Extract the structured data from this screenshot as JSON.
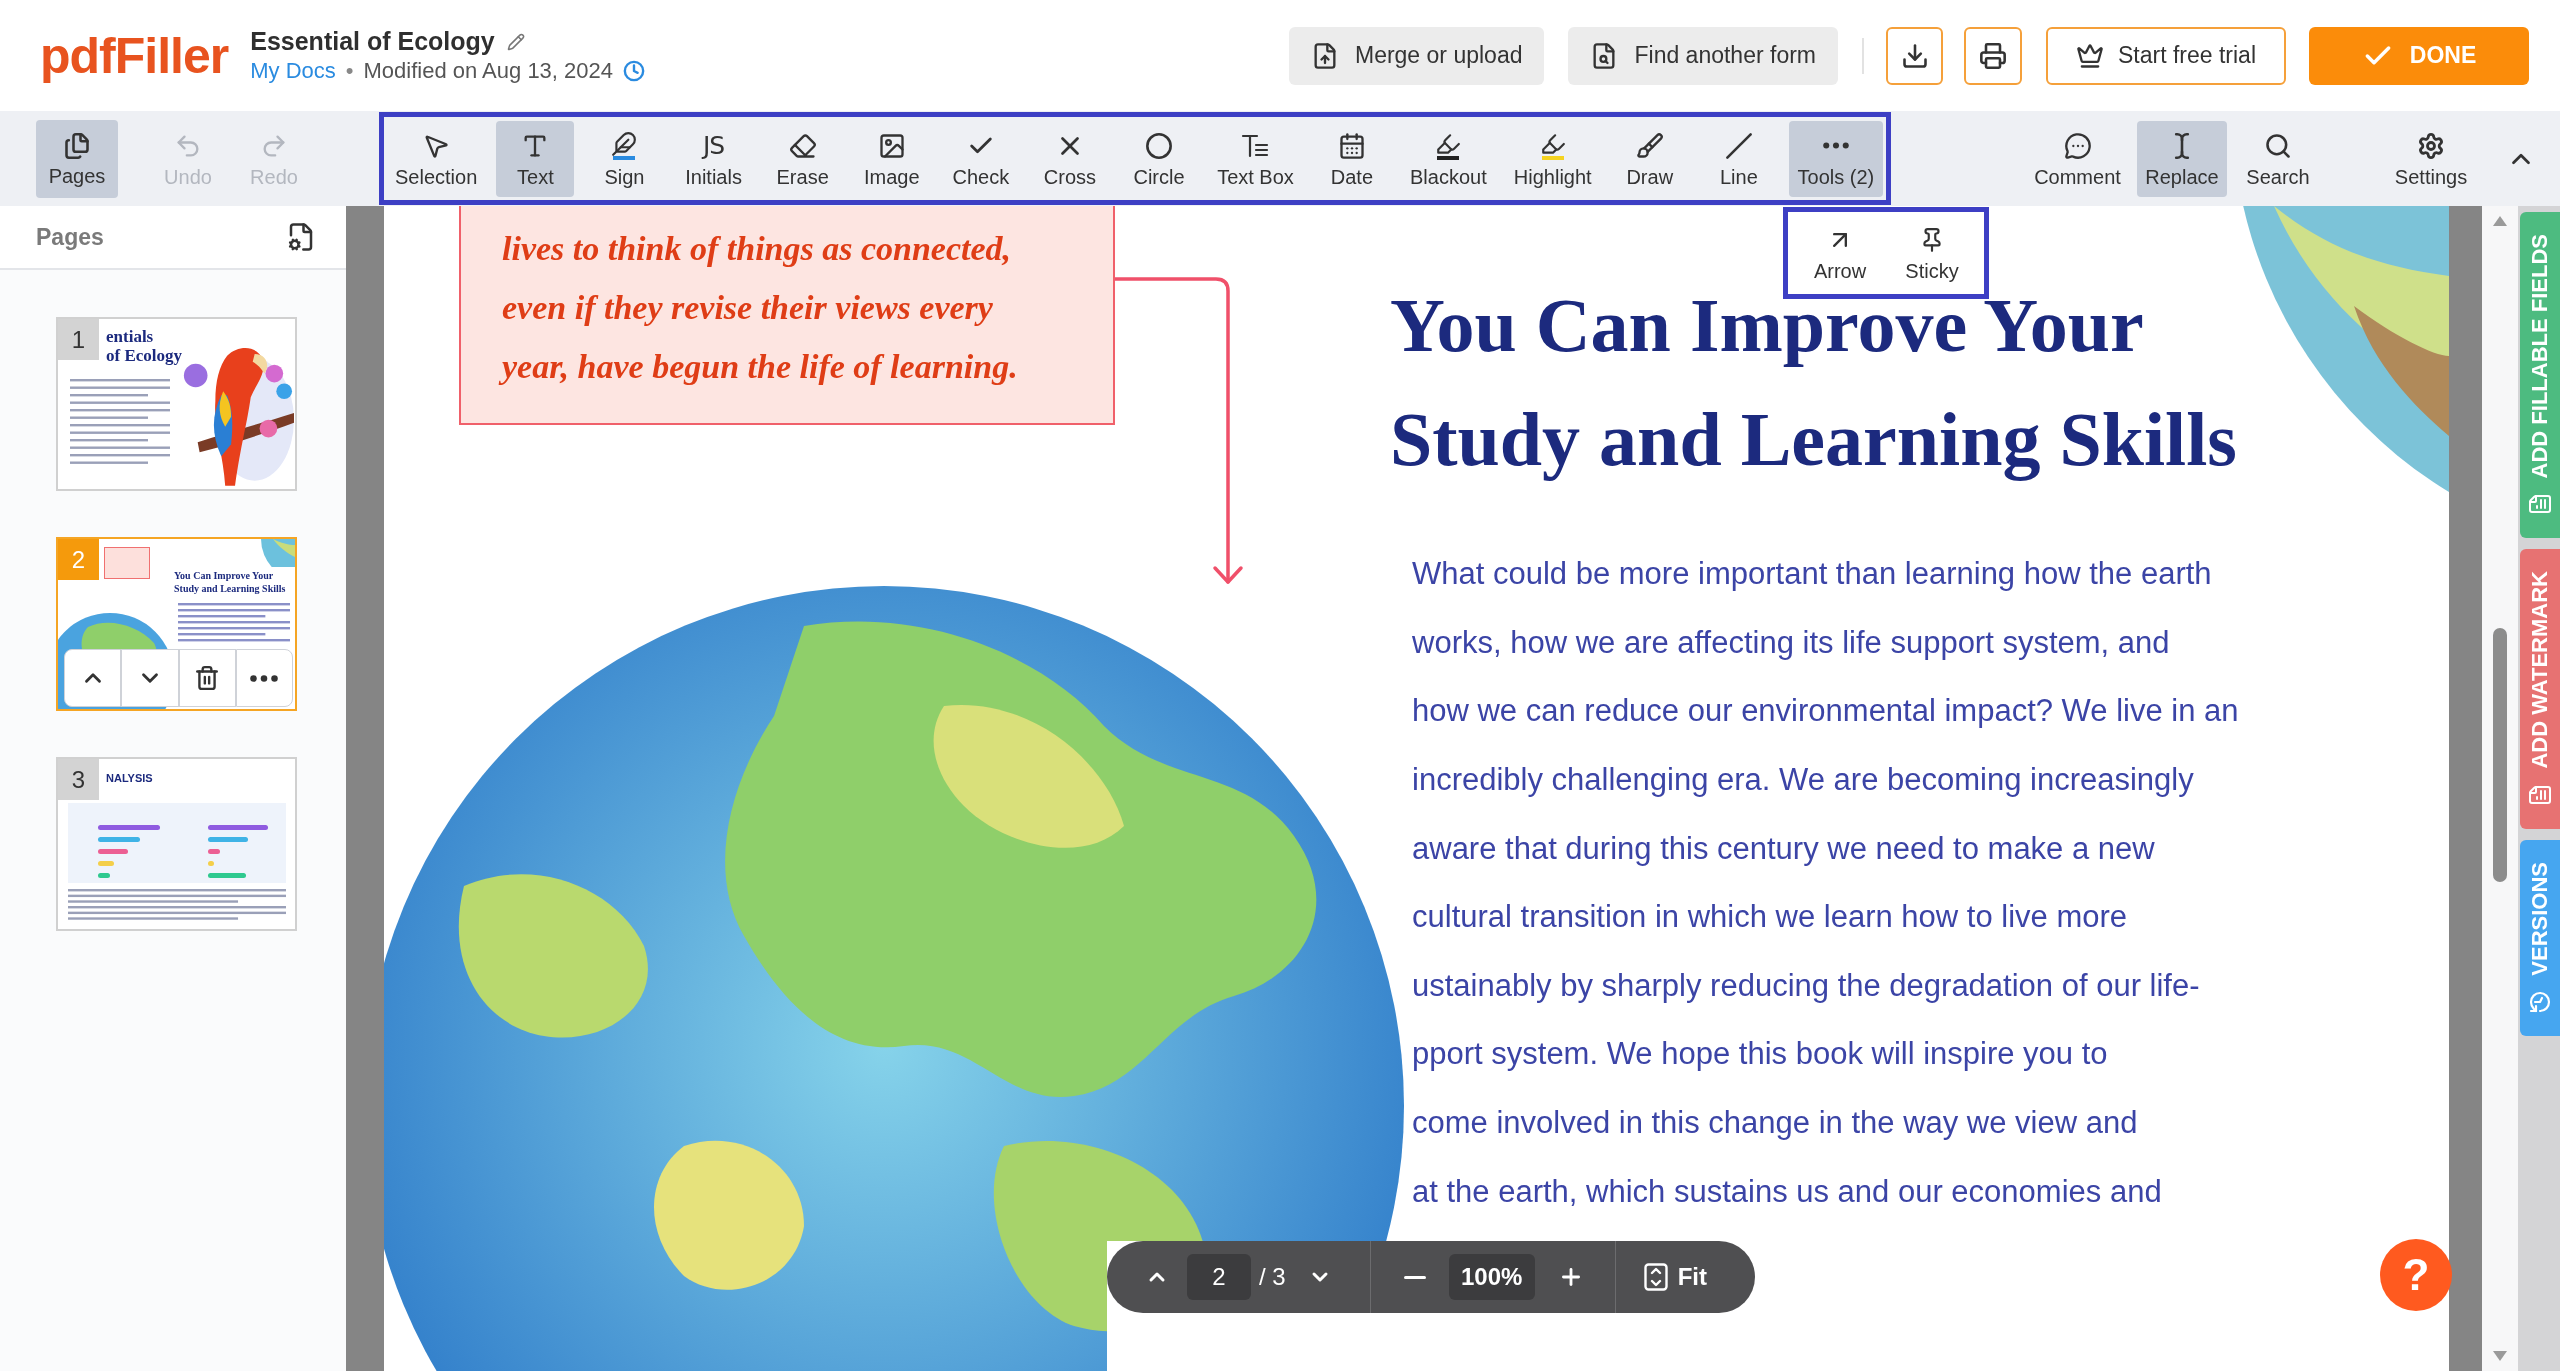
{
  "header": {
    "logo": "pdfFiller",
    "title": "Essential of Ecology",
    "location": "My Docs",
    "separator": "•",
    "modified": "Modified on Aug 13, 2024",
    "actions": [
      {
        "kind": "merge",
        "label": "Merge or upload"
      },
      {
        "kind": "find",
        "label": "Find another form"
      },
      {
        "kind": "download"
      },
      {
        "kind": "print"
      },
      {
        "kind": "trial",
        "label": "Start free trial"
      },
      {
        "kind": "done",
        "label": "DONE"
      }
    ]
  },
  "toolbar": {
    "pages": {
      "label": "Pages",
      "selected": true
    },
    "history": [
      {
        "kind": "undo",
        "label": "Undo",
        "disabled": true
      },
      {
        "kind": "redo",
        "label": "Redo",
        "disabled": true
      }
    ],
    "tools": [
      {
        "kind": "selection",
        "label": "Selection",
        "selected": false
      },
      {
        "kind": "text",
        "label": "Text",
        "selected": true
      },
      {
        "kind": "sign",
        "label": "Sign",
        "selected": false
      },
      {
        "kind": "initials",
        "label": "Initials",
        "glyph": "JS",
        "selected": false
      },
      {
        "kind": "erase",
        "label": "Erase",
        "selected": false
      },
      {
        "kind": "image",
        "label": "Image",
        "selected": false
      },
      {
        "kind": "check",
        "label": "Check",
        "selected": false
      },
      {
        "kind": "cross",
        "label": "Cross",
        "selected": false
      },
      {
        "kind": "circle",
        "label": "Circle",
        "selected": false
      },
      {
        "kind": "textbox",
        "label": "Text Box",
        "selected": false
      },
      {
        "kind": "date",
        "label": "Date",
        "selected": false
      },
      {
        "kind": "blackout",
        "label": "Blackout",
        "selected": false
      },
      {
        "kind": "highlight",
        "label": "Highlight",
        "selected": false
      },
      {
        "kind": "draw",
        "label": "Draw",
        "selected": false
      },
      {
        "kind": "line",
        "label": "Line",
        "selected": false
      }
    ],
    "more_tools": {
      "label": "Tools (2)",
      "expanded": true,
      "items": [
        {
          "kind": "arrow",
          "label": "Arrow"
        },
        {
          "kind": "sticky",
          "label": "Sticky"
        }
      ]
    },
    "right_tools": [
      {
        "kind": "comment",
        "label": "Comment",
        "selected": false
      },
      {
        "kind": "replace",
        "label": "Replace",
        "selected": true
      },
      {
        "kind": "search",
        "label": "Search",
        "selected": false
      },
      {
        "kind": "settings",
        "label": "Settings",
        "selected": false
      }
    ]
  },
  "pages_panel": {
    "title": "Pages",
    "thumbnails": [
      {
        "number": "1",
        "kind": "cover",
        "title_lines": [
          "entials",
          "of Ecology"
        ],
        "selected": false
      },
      {
        "number": "2",
        "kind": "globe",
        "title_lines": [
          "You Can Improve Your",
          "Study and Learning Skills"
        ],
        "selected": true
      },
      {
        "number": "3",
        "kind": "chart",
        "title_lines": [
          "NALYSIS"
        ],
        "selected": false
      }
    ]
  },
  "document": {
    "callout_lines": [
      "lives to think of things as connected,",
      "even if they revise their views every",
      "year, have begun the life of learning."
    ],
    "heading_lines": [
      "You Can Improve Your",
      "Study and Learning Skills"
    ],
    "body_lines": [
      "What could be more important than learning how the earth",
      "works, how we are affecting its life support system, and",
      "how we can reduce our environmental impact? We live in an",
      "incredibly challenging era. We are becoming increasingly",
      "aware that during this century we need to make a new",
      "cultural transition in which we learn how to live more",
      "ustainably by sharply reducing the degradation of our life-",
      "pport system. We hope this book will inspire you to",
      "come involved in this change in the way we view and",
      "at the earth, which sustains us and our economies and"
    ]
  },
  "zoom_bar": {
    "page": "2",
    "total": "/ 3",
    "zoom": "100%",
    "fit": "Fit"
  },
  "help": {
    "label": "?"
  },
  "side_tabs": [
    {
      "kind": "fields",
      "label": "ADD FILLABLE FIELDS",
      "color": "#4dbb80"
    },
    {
      "kind": "watermark",
      "label": "ADD WATERMARK",
      "color": "#e77272"
    },
    {
      "kind": "versions",
      "label": "VERSIONS",
      "color": "#46a6f0"
    }
  ]
}
